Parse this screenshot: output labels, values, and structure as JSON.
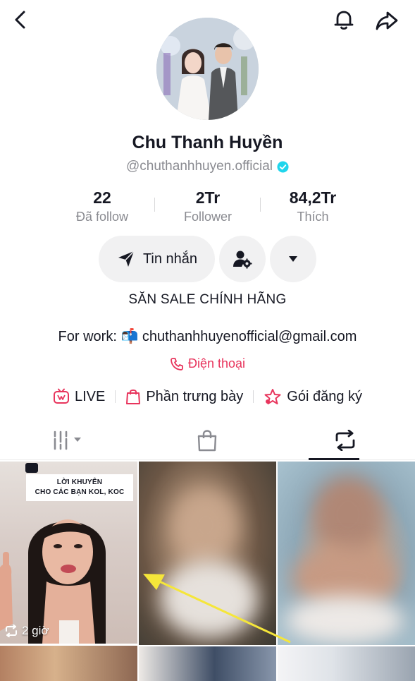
{
  "topbar": {
    "back_icon": "chevron-left-icon",
    "bell_icon": "bell-icon",
    "share_icon": "share-icon"
  },
  "profile": {
    "name": "Chu Thanh Huyền",
    "handle": "@chuthanhhuyen.official",
    "verified": true,
    "stats": [
      {
        "value": "22",
        "label": "Đã follow"
      },
      {
        "value": "2Tr",
        "label": "Follower"
      },
      {
        "value": "84,2Tr",
        "label": "Thích"
      }
    ],
    "message_button": "Tin nhắn",
    "bio": "SĂN SALE CHÍNH HÃNG",
    "work_line": "For work: 📬 chuthanhhuyenofficial@gmail.com",
    "phone_link": "Điện thoại",
    "accent_color": "#e8355d"
  },
  "links": [
    {
      "label": "LIVE",
      "icon": "live-icon"
    },
    {
      "label": "Phần trưng bày",
      "icon": "shopping-bag-icon"
    },
    {
      "label": "Gói đăng ký",
      "icon": "subscription-star-icon"
    }
  ],
  "tabs": [
    {
      "icon": "videos-grid-icon",
      "active": false
    },
    {
      "icon": "shop-bag-icon",
      "active": false
    },
    {
      "icon": "repost-icon",
      "active": true
    }
  ],
  "grid": {
    "first_video": {
      "caption_line1": "LỜI KHUYÊN",
      "caption_line2": "CHO CÁC BẠN KOL, KOC",
      "time": "2 giờ"
    }
  }
}
